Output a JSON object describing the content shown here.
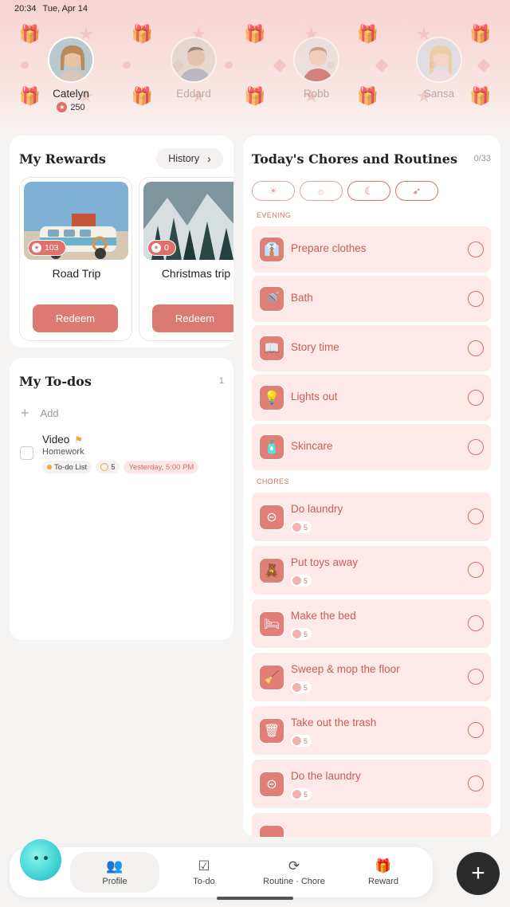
{
  "status_bar": {
    "time": "20:34",
    "date": "Tue, Apr 14"
  },
  "profiles": [
    {
      "name": "Catelyn",
      "points": "250",
      "active": true
    },
    {
      "name": "Eddard",
      "active": false
    },
    {
      "name": "Robb",
      "active": false
    },
    {
      "name": "Sansa",
      "active": false
    }
  ],
  "rewards": {
    "title": "My Rewards",
    "history_label": "History",
    "items": [
      {
        "name": "Road Trip",
        "points": "103",
        "redeem_label": "Redeem"
      },
      {
        "name": "Christmas trip",
        "points": "0",
        "redeem_label": "Redeem"
      }
    ]
  },
  "todos": {
    "title": "My To-dos",
    "count": "1",
    "add_label": "Add",
    "items": [
      {
        "title": "Video",
        "subtitle": "Homework",
        "list": "To-do List",
        "points": "5",
        "due": "Yesterday, 5:00 PM"
      }
    ]
  },
  "chores": {
    "title": "Today's Chores and Routines",
    "count": "0/33",
    "sections": {
      "evening": "EVENING",
      "chores": "CHORES"
    },
    "evening_items": [
      {
        "name": "Prepare clothes",
        "icon": "shirt-icon"
      },
      {
        "name": "Bath",
        "icon": "shower-icon"
      },
      {
        "name": "Story time",
        "icon": "book-icon"
      },
      {
        "name": "Lights out",
        "icon": "lightbulb-off-icon"
      },
      {
        "name": "Skincare",
        "icon": "lotion-icon"
      }
    ],
    "chore_items": [
      {
        "name": "Do laundry",
        "points": "5",
        "icon": "washing-machine-icon"
      },
      {
        "name": "Put toys away",
        "points": "5",
        "icon": "teddy-bear-icon"
      },
      {
        "name": "Make the bed",
        "points": "5",
        "icon": "bed-icon"
      },
      {
        "name": "Sweep & mop the floor",
        "points": "5",
        "icon": "broom-icon"
      },
      {
        "name": "Take out the trash",
        "points": "5",
        "icon": "trash-icon"
      },
      {
        "name": "Do the laundry",
        "points": "5",
        "icon": "washing-machine-icon"
      }
    ]
  },
  "nav": {
    "profile": "Profile",
    "todo": "To-do",
    "routine": "Routine · Chore",
    "reward": "Reward"
  },
  "colors": {
    "accent": "#dc7a72",
    "chore_bg": "#fde9e7",
    "fab": "#2b2b2b"
  }
}
